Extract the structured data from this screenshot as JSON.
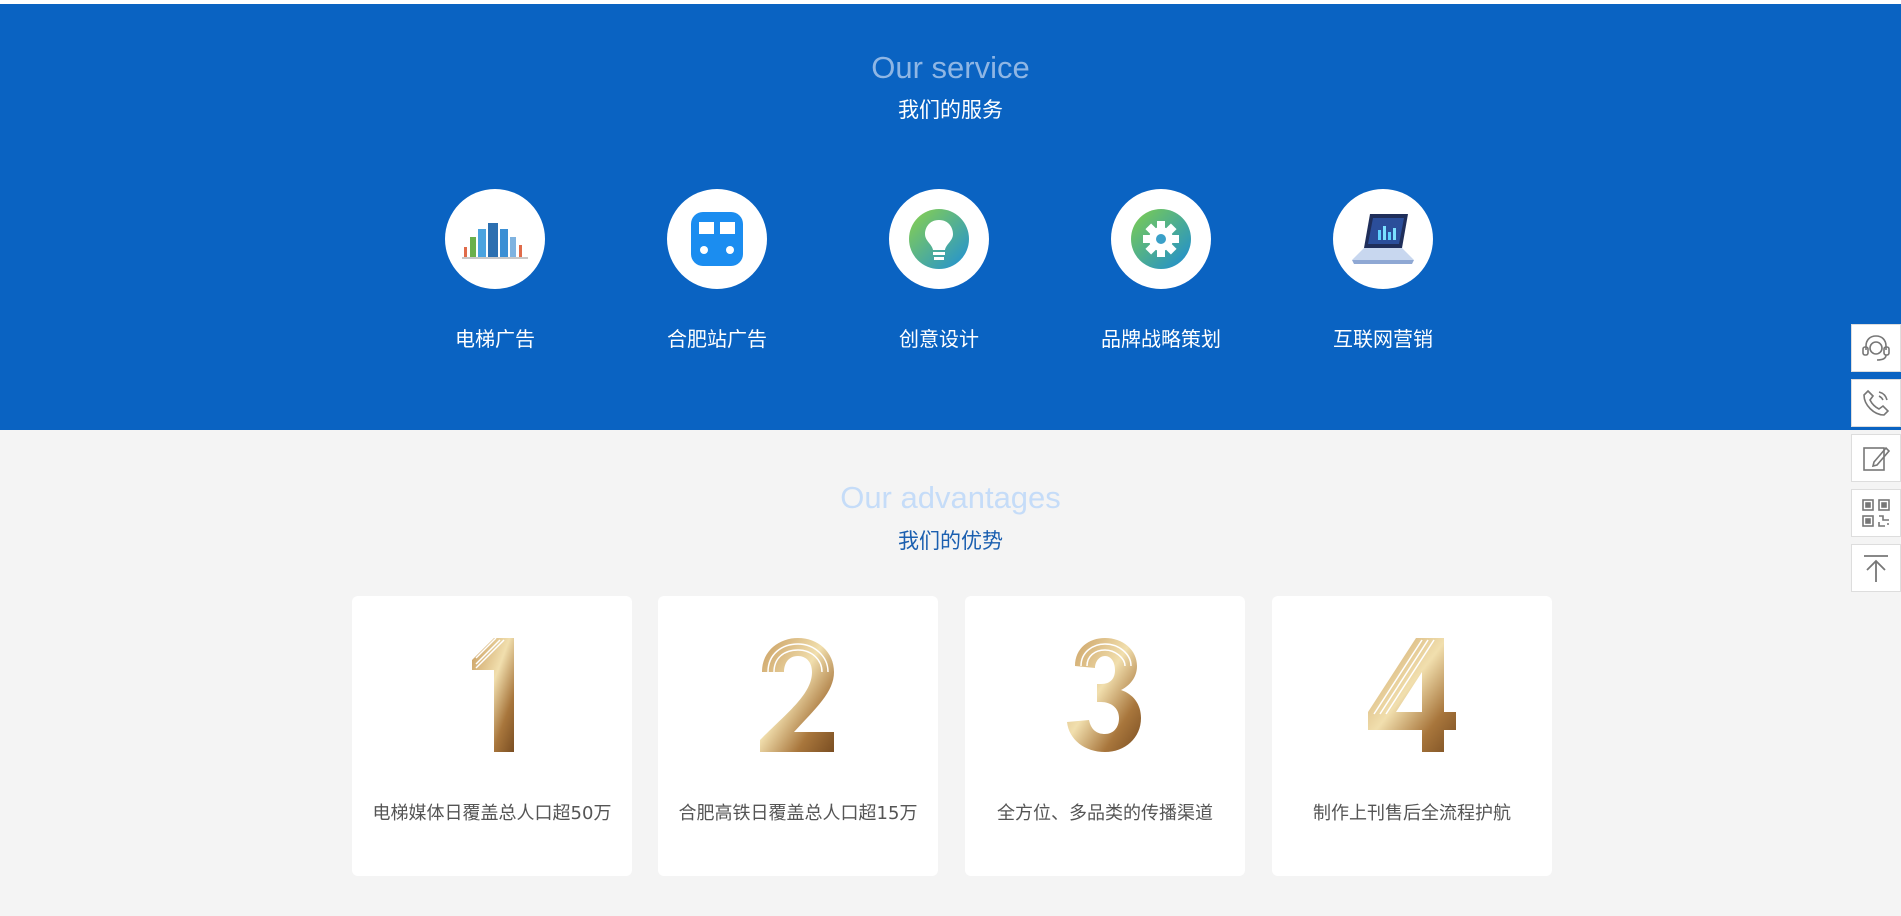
{
  "service": {
    "title_en": "Our service",
    "title_cn": "我们的服务",
    "items": [
      {
        "label": "电梯广告",
        "icon": "bar-chart-icon"
      },
      {
        "label": "合肥站广告",
        "icon": "train-icon"
      },
      {
        "label": "创意设计",
        "icon": "lightbulb-icon"
      },
      {
        "label": "品牌战略策划",
        "icon": "gear-icon"
      },
      {
        "label": "互联网营销",
        "icon": "laptop-icon"
      }
    ]
  },
  "advantages": {
    "title_en": "Our advantages",
    "title_cn": "我们的优势",
    "items": [
      {
        "number": "1",
        "text": "电梯媒体日覆盖总人口超50万"
      },
      {
        "number": "2",
        "text": "合肥高铁日覆盖总人口超15万"
      },
      {
        "number": "3",
        "text": "全方位、多品类的传播渠道"
      },
      {
        "number": "4",
        "text": "制作上刊售后全流程护航"
      }
    ]
  },
  "sidebar": {
    "buttons": [
      {
        "icon": "customer-service-icon"
      },
      {
        "icon": "phone-icon"
      },
      {
        "icon": "edit-icon"
      },
      {
        "icon": "qr-code-icon"
      },
      {
        "icon": "back-to-top-icon"
      }
    ]
  },
  "colors": {
    "service_bg": "#0a63c2",
    "page_bg": "#f4f4f4",
    "gold_light": "#f0dca8",
    "gold_dark": "#8a5a2a"
  }
}
